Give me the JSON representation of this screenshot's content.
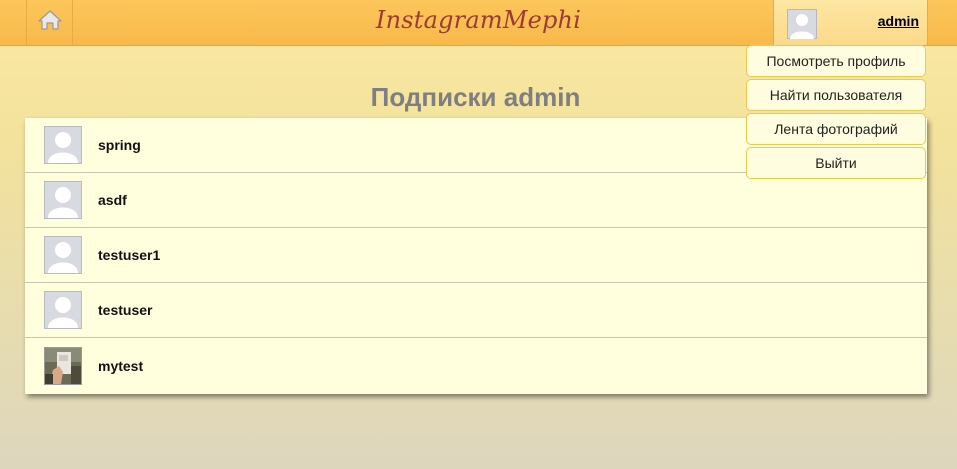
{
  "header": {
    "logo_text": "InstagramMephi",
    "home_icon": "home-icon",
    "user": {
      "name": "admin",
      "avatar": "default-avatar-icon"
    }
  },
  "menu": {
    "items": [
      {
        "label": "Посмотреть профиль"
      },
      {
        "label": "Найти пользователя"
      },
      {
        "label": "Лента фотографий"
      },
      {
        "label": "Выйти"
      }
    ]
  },
  "page": {
    "title": "Подписки admin"
  },
  "subscriptions": [
    {
      "username": "spring",
      "avatar": "default-avatar-icon"
    },
    {
      "username": "asdf",
      "avatar": "default-avatar-icon"
    },
    {
      "username": "testuser1",
      "avatar": "default-avatar-icon"
    },
    {
      "username": "testuser",
      "avatar": "default-avatar-icon"
    },
    {
      "username": "mytest",
      "avatar": "photo-avatar"
    }
  ],
  "colors": {
    "header": "#f8b94a",
    "logo": "#9d3b35",
    "list_bg": "#fffedd",
    "menu_border": "#f0c94a",
    "title": "#7f7f7f"
  }
}
